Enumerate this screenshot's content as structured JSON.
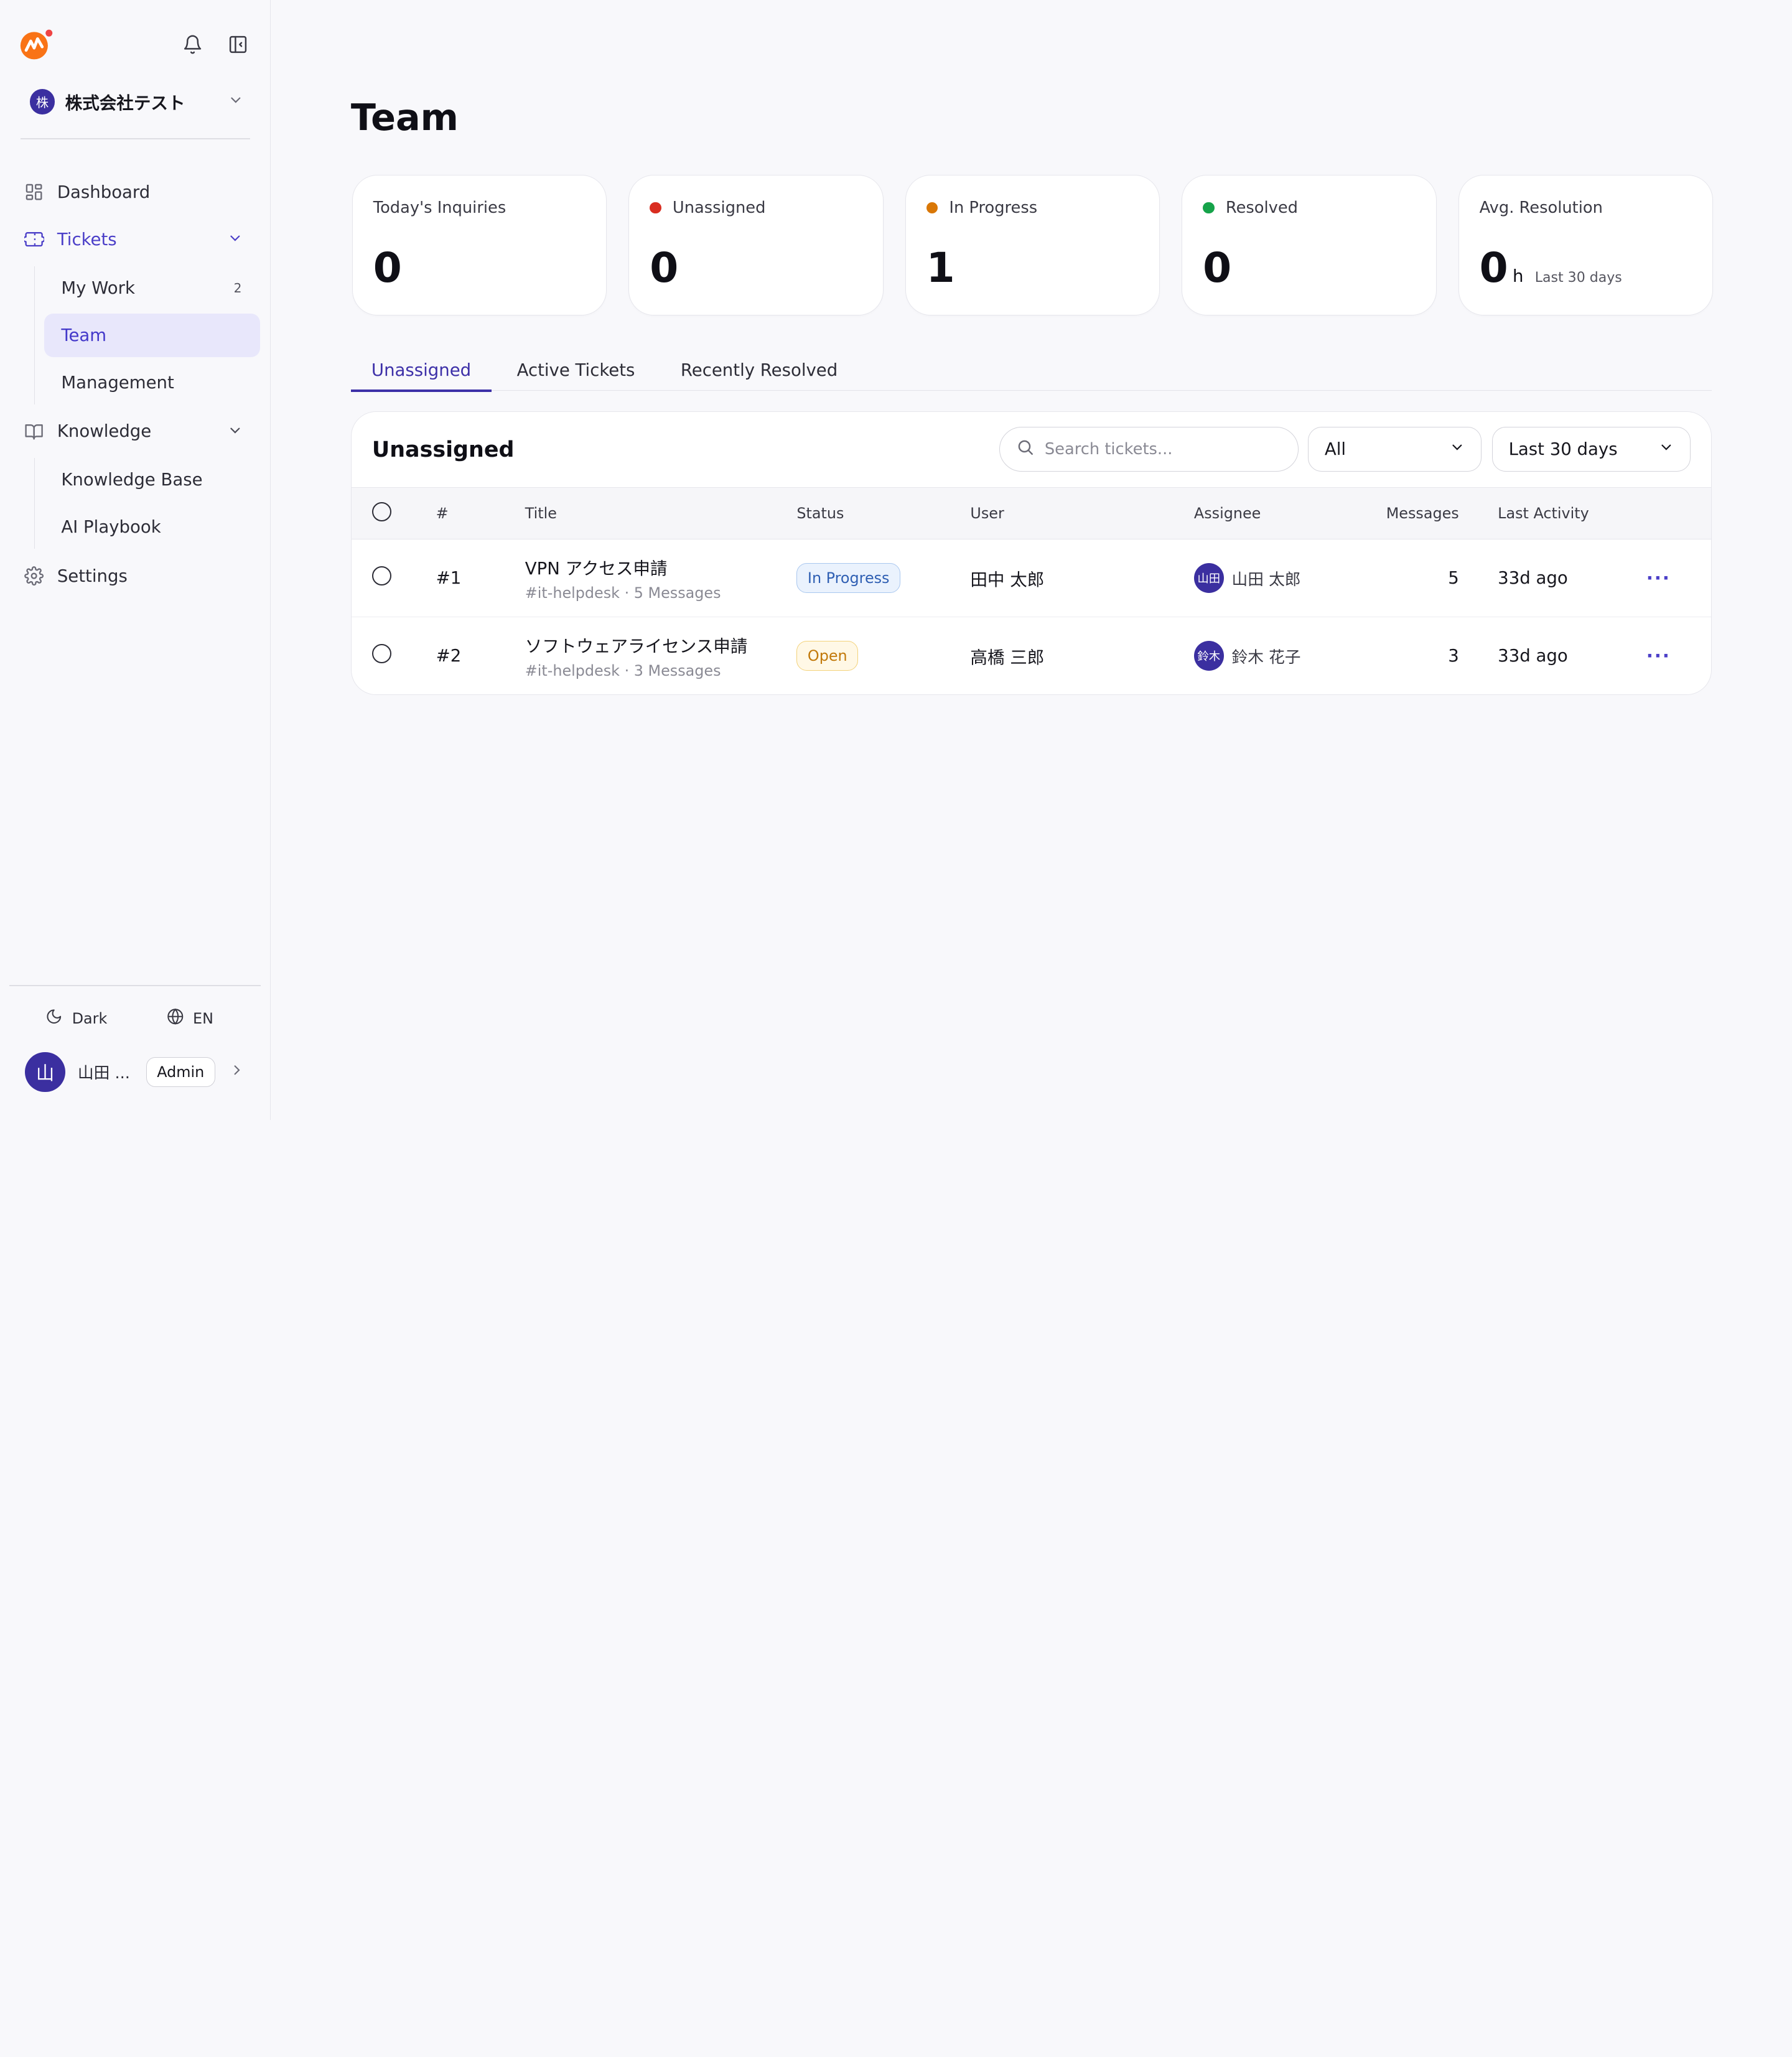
{
  "colors": {
    "accent": "#4b3fc8",
    "red": "#d92d20",
    "orange": "#d97706",
    "green": "#16a34a",
    "logo": "#f97316"
  },
  "sidebar": {
    "org": {
      "badge": "株",
      "name": "株式会社テスト"
    },
    "nav": {
      "dashboard": "Dashboard",
      "tickets": "Tickets",
      "my_work": "My Work",
      "my_work_count": "2",
      "team": "Team",
      "management": "Management",
      "knowledge": "Knowledge",
      "knowledge_base": "Knowledge Base",
      "ai_playbook": "AI Playbook",
      "settings": "Settings"
    },
    "prefs": {
      "theme": "Dark",
      "language": "EN"
    },
    "user": {
      "avatar": "山",
      "name": "山田 ...",
      "role": "Admin"
    }
  },
  "page": {
    "title": "Team"
  },
  "stats": [
    {
      "label": "Today's Inquiries",
      "value": "0"
    },
    {
      "label": "Unassigned",
      "value": "0"
    },
    {
      "label": "In Progress",
      "value": "1"
    },
    {
      "label": "Resolved",
      "value": "0"
    },
    {
      "label": "Avg. Resolution",
      "value": "0",
      "unit": "h",
      "sub": "Last 30 days"
    }
  ],
  "tabs": [
    "Unassigned",
    "Active Tickets",
    "Recently Resolved"
  ],
  "table_card": {
    "title": "Unassigned",
    "search_placeholder": "Search tickets...",
    "filter_status": "All",
    "filter_range": "Last 30 days",
    "columns": [
      "#",
      "Title",
      "Status",
      "User",
      "Assignee",
      "Messages",
      "Last Activity"
    ],
    "rows": [
      {
        "id": "#1",
        "title": "VPN アクセス申請",
        "sub": "#it-helpdesk · 5 Messages",
        "status": "In Progress",
        "user": "田中 太郎",
        "assignee_avatar": "山田",
        "assignee": "山田 太郎",
        "messages": "5",
        "last_activity": "33d ago"
      },
      {
        "id": "#2",
        "title": "ソフトウェアライセンス申請",
        "sub": "#it-helpdesk · 3 Messages",
        "status": "Open",
        "user": "高橋 三郎",
        "assignee_avatar": "鈴木",
        "assignee": "鈴木 花子",
        "messages": "3",
        "last_activity": "33d ago"
      }
    ]
  }
}
